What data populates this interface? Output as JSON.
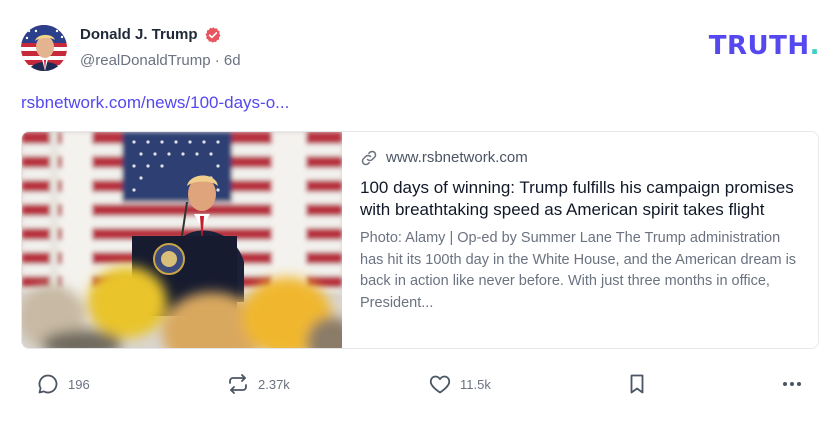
{
  "post": {
    "author": {
      "name": "Donald J. Trump",
      "handle": "@realDonaldTrump",
      "separator": "·",
      "age": "6d",
      "verified": true,
      "avatar_icon": "user-avatar"
    },
    "brand": {
      "logo_text": "TRUTH",
      "logo_dot": ".",
      "color_primary": "#5448ee",
      "color_dot": "#3fd1c3"
    },
    "link_text": "rsbnetwork.com/news/100-days-o...",
    "card": {
      "domain": "www.rsbnetwork.com",
      "title": "100 days of winning: Trump fulfills his campaign promises with breathtaking speed as American spirit takes flight",
      "description": "Photo: Alamy | Op-ed by Summer Lane The Trump administration has hit its 100th day in the White House, and the American dream is back in action like never before. With just three months in office, President...",
      "image_icon": "article-photo"
    },
    "actions": {
      "reply_count": "196",
      "retruth_count": "2.37k",
      "like_count": "11.5k"
    }
  }
}
